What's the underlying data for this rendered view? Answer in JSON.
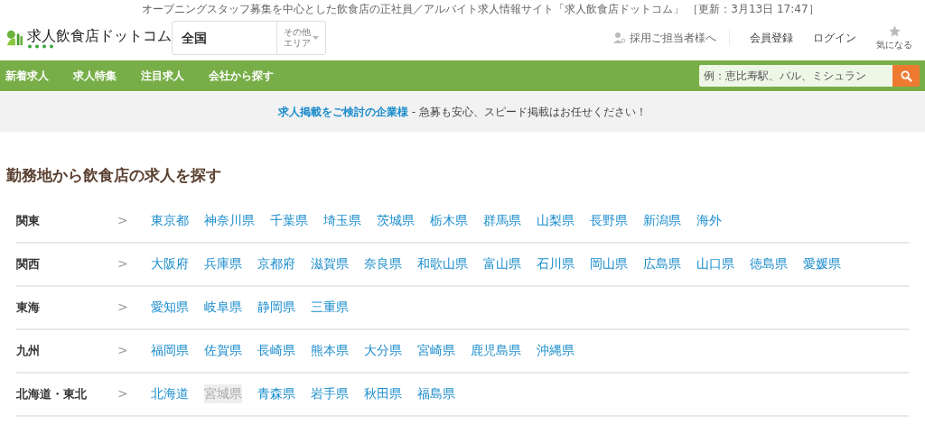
{
  "tagline": "オープニングスタッフ募集を中心とした飲食店の正社員／アルバイト求人情報サイト「求人飲食店ドットコム」 ［更新：3月13日 17:47］",
  "logo": {
    "text": "求人飲食店ドットコム"
  },
  "area_select": {
    "value": "全国",
    "other_label": [
      "その他",
      "エリア"
    ]
  },
  "header_links": [
    {
      "label": "採用ご担当者様へ",
      "kind": "recruiter"
    },
    {
      "label": "会員登録",
      "kind": "plain"
    },
    {
      "label": "ログイン",
      "kind": "plain"
    }
  ],
  "favorites": {
    "label": "気になる"
  },
  "nav": {
    "items": [
      "新着求人",
      "求人特集",
      "注目求人",
      "会社から探す"
    ],
    "search": {
      "placeholder": "例：恵比寿駅、バル、ミシュラン"
    }
  },
  "banner": {
    "link": "求人掲載をご検討の企業様",
    "text": " - 急募も安心、スピード掲載はお任せください！"
  },
  "heading": "勤務地から飲食店の求人を探す",
  "regions": [
    {
      "name": "関東",
      "chevron": ">",
      "prefectures": [
        {
          "name": "東京都",
          "disabled": false
        },
        {
          "name": "神奈川県",
          "disabled": false
        },
        {
          "name": "千葉県",
          "disabled": false
        },
        {
          "name": "埼玉県",
          "disabled": false
        },
        {
          "name": "茨城県",
          "disabled": false
        },
        {
          "name": "栃木県",
          "disabled": false
        },
        {
          "name": "群馬県",
          "disabled": false
        },
        {
          "name": "山梨県",
          "disabled": false
        },
        {
          "name": "長野県",
          "disabled": false
        },
        {
          "name": "新潟県",
          "disabled": false
        },
        {
          "name": "海外",
          "disabled": false
        }
      ]
    },
    {
      "name": "関西",
      "chevron": ">",
      "prefectures": [
        {
          "name": "大阪府",
          "disabled": false
        },
        {
          "name": "兵庫県",
          "disabled": false
        },
        {
          "name": "京都府",
          "disabled": false
        },
        {
          "name": "滋賀県",
          "disabled": false
        },
        {
          "name": "奈良県",
          "disabled": false
        },
        {
          "name": "和歌山県",
          "disabled": false
        },
        {
          "name": "富山県",
          "disabled": false
        },
        {
          "name": "石川県",
          "disabled": false
        },
        {
          "name": "岡山県",
          "disabled": false
        },
        {
          "name": "広島県",
          "disabled": false
        },
        {
          "name": "山口県",
          "disabled": false
        },
        {
          "name": "徳島県",
          "disabled": false
        },
        {
          "name": "愛媛県",
          "disabled": false
        }
      ]
    },
    {
      "name": "東海",
      "chevron": ">",
      "prefectures": [
        {
          "name": "愛知県",
          "disabled": false
        },
        {
          "name": "岐阜県",
          "disabled": false
        },
        {
          "name": "静岡県",
          "disabled": false
        },
        {
          "name": "三重県",
          "disabled": false
        }
      ]
    },
    {
      "name": "九州",
      "chevron": ">",
      "prefectures": [
        {
          "name": "福岡県",
          "disabled": false
        },
        {
          "name": "佐賀県",
          "disabled": false
        },
        {
          "name": "長崎県",
          "disabled": false
        },
        {
          "name": "熊本県",
          "disabled": false
        },
        {
          "name": "大分県",
          "disabled": false
        },
        {
          "name": "宮崎県",
          "disabled": false
        },
        {
          "name": "鹿児島県",
          "disabled": false
        },
        {
          "name": "沖縄県",
          "disabled": false
        }
      ]
    },
    {
      "name": "北海道・東北",
      "chevron": ">",
      "prefectures": [
        {
          "name": "北海道",
          "disabled": false
        },
        {
          "name": "宮城県",
          "disabled": true
        },
        {
          "name": "青森県",
          "disabled": false
        },
        {
          "name": "岩手県",
          "disabled": false
        },
        {
          "name": "秋田県",
          "disabled": false
        },
        {
          "name": "福島県",
          "disabled": false
        }
      ]
    }
  ]
}
